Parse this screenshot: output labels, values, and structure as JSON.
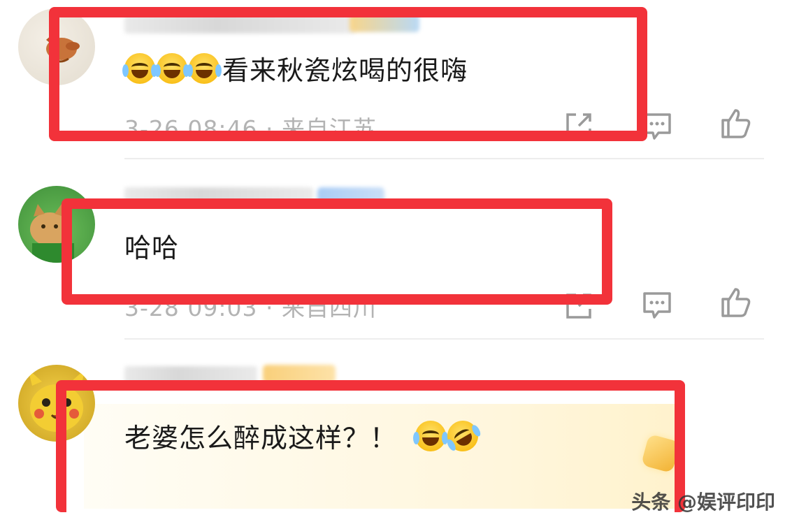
{
  "comments": [
    {
      "text": "看来秋瓷炫喝的很嗨",
      "emoji_count": 3,
      "meta": "3-26 08:46 · 来自江苏"
    },
    {
      "text": "哈哈",
      "meta": "3-28 09:03 · 来自四川"
    },
    {
      "text": "老婆怎么醉成这样？！"
    }
  ],
  "footer": {
    "watermark": "头条 @娱评印印"
  },
  "colors": {
    "highlight_box": "#f2323a",
    "meta_text": "#b3b3b3"
  },
  "icons": [
    "share-icon",
    "reply-icon",
    "like-icon"
  ]
}
